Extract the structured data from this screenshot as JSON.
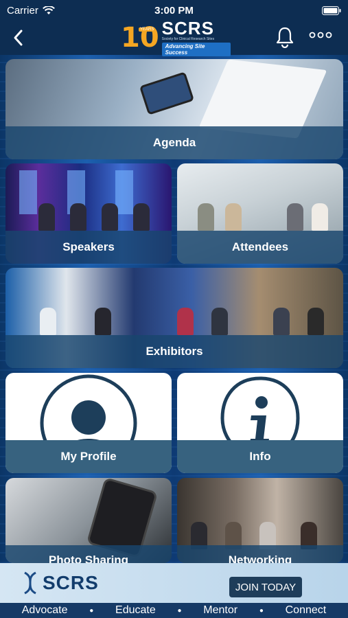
{
  "status_bar": {
    "carrier": "Carrier",
    "time": "3:00 PM"
  },
  "header": {
    "logo_ten": "10",
    "logo_years": "YEARS",
    "logo_name": "SCRS",
    "logo_subtitle": "Society for Clinical Research Sites",
    "logo_tagline": "Advancing Site Success",
    "icons": [
      "back-chevron-icon",
      "bell-icon",
      "more-icon"
    ]
  },
  "tiles": {
    "agenda": "Agenda",
    "speakers": "Speakers",
    "attendees": "Attendees",
    "exhibitors": "Exhibitors",
    "my_profile": "My Profile",
    "info": "Info",
    "photo_sharing": "Photo Sharing",
    "networking": "Networking"
  },
  "footer": {
    "logo": "SCRS",
    "join_button": "JOIN TODAY",
    "motto": [
      "Advocate",
      "Educate",
      "Mentor",
      "Connect"
    ]
  },
  "colors": {
    "header_bg": "#0d2d52",
    "tile_label_bg": "#37627f",
    "icon_dark": "#1d3e5a",
    "accent_orange": "#f4a623"
  }
}
